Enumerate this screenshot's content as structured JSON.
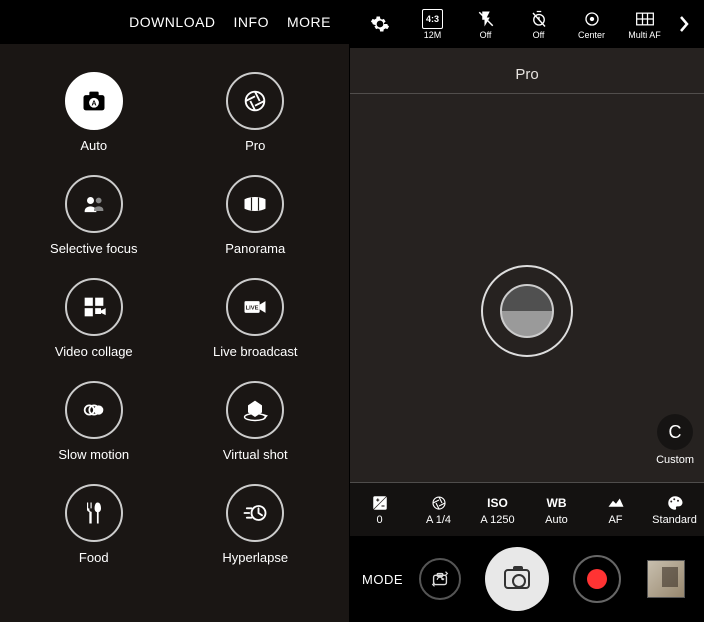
{
  "left": {
    "top_menu": {
      "download": "DOWNLOAD",
      "info": "INFO",
      "more": "MORE"
    },
    "modes": [
      {
        "id": "auto",
        "label": "Auto",
        "filled": true
      },
      {
        "id": "pro",
        "label": "Pro"
      },
      {
        "id": "selective-focus",
        "label": "Selective focus"
      },
      {
        "id": "panorama",
        "label": "Panorama"
      },
      {
        "id": "video-collage",
        "label": "Video collage"
      },
      {
        "id": "live-broadcast",
        "label": "Live broadcast"
      },
      {
        "id": "slow-motion",
        "label": "Slow motion"
      },
      {
        "id": "virtual-shot",
        "label": "Virtual shot"
      },
      {
        "id": "food",
        "label": "Food"
      },
      {
        "id": "hyperlapse",
        "label": "Hyperlapse"
      }
    ]
  },
  "right": {
    "top": [
      {
        "id": "settings",
        "label": ""
      },
      {
        "id": "ratio",
        "label": "12M",
        "badge": "4:3"
      },
      {
        "id": "flash",
        "label": "Off"
      },
      {
        "id": "timer",
        "label": "Off"
      },
      {
        "id": "metering",
        "label": "Center"
      },
      {
        "id": "af-area",
        "label": "Multi AF"
      }
    ],
    "mode_title": "Pro",
    "custom_label": "Custom",
    "custom_letter": "C",
    "params": [
      {
        "id": "exposure",
        "icon": "ev",
        "value": "0"
      },
      {
        "id": "shutter",
        "icon": "aperture",
        "value": "A 1/4"
      },
      {
        "id": "iso",
        "icon": "iso-text",
        "value": "A 1250",
        "icon_label": "ISO"
      },
      {
        "id": "wb",
        "icon": "wb-text",
        "value": "Auto",
        "icon_label": "WB"
      },
      {
        "id": "focus",
        "icon": "focus",
        "value": "AF"
      },
      {
        "id": "effect",
        "icon": "palette",
        "value": "Standard"
      }
    ],
    "bottom": {
      "mode": "MODE"
    }
  }
}
